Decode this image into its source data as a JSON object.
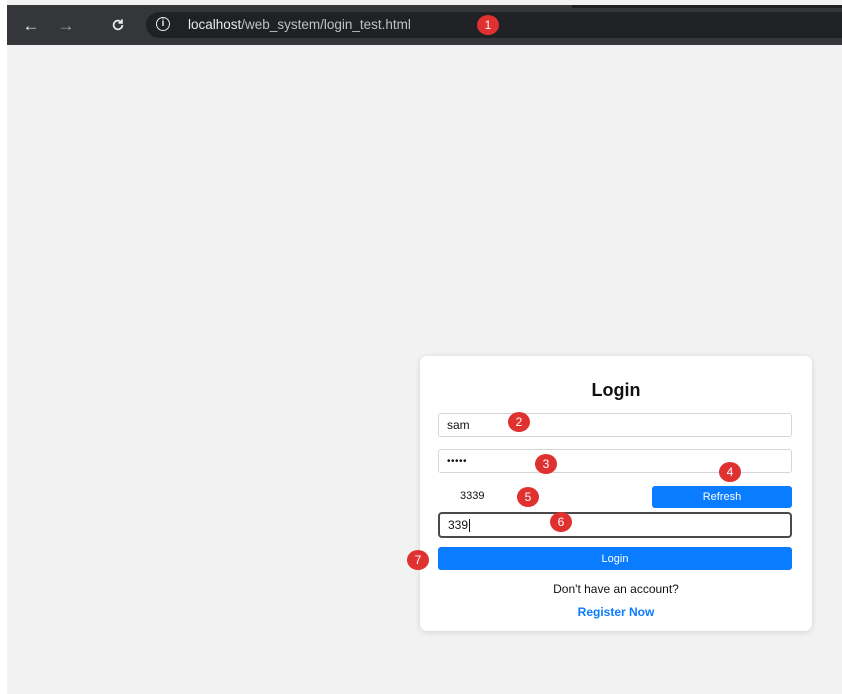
{
  "browser": {
    "url_host": "localhost",
    "url_path": "/web_system/login_test.html",
    "back_icon": "arrow-left-icon",
    "forward_icon": "arrow-right-icon",
    "reload_icon": "reload-icon",
    "info_icon": "info-icon"
  },
  "badges": [
    "1",
    "2",
    "3",
    "4",
    "5",
    "6",
    "7"
  ],
  "login": {
    "title": "Login",
    "username_value": "sam",
    "password_value": "•••••",
    "captcha_code": "3339",
    "refresh_label": "Refresh",
    "captcha_input_value": "339",
    "login_button_label": "Login",
    "no_account_text": "Don't have an account?",
    "register_link": "Register Now"
  },
  "colors": {
    "primary": "#0a7cff",
    "badge": "#e03131",
    "toolbar": "#35363a"
  }
}
